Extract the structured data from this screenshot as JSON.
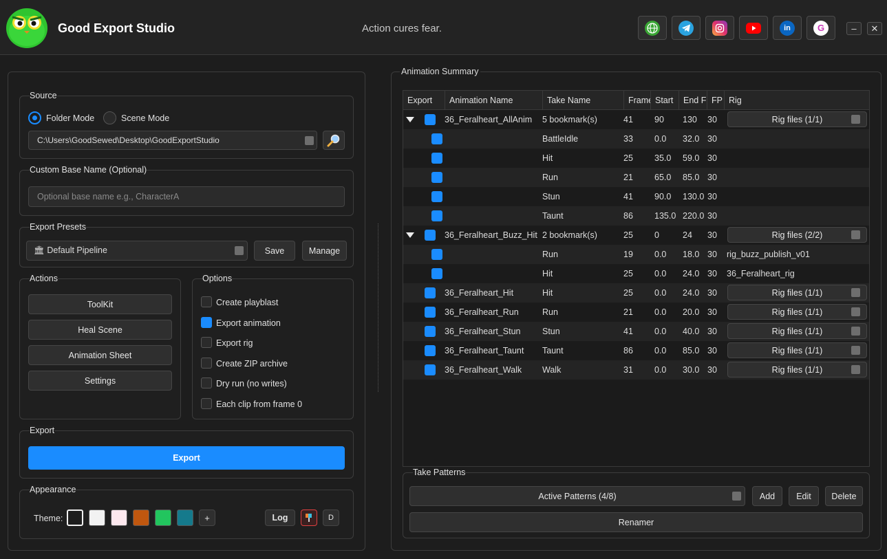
{
  "app": {
    "title": "Good Export Studio",
    "tagline": "Action cures fear."
  },
  "social_icons": [
    {
      "name": "globe-icon",
      "color": "#3aa635"
    },
    {
      "name": "telegram-icon",
      "color": "#2aa3e0"
    },
    {
      "name": "instagram-icon",
      "color": "#e1306c"
    },
    {
      "name": "youtube-icon",
      "color": "#ff0000"
    },
    {
      "name": "linkedin-icon",
      "color": "#0a66c2"
    },
    {
      "name": "g-logo-icon",
      "color": "#e040c0",
      "glyph": "G"
    }
  ],
  "window": {
    "minimize": "–",
    "close": "✕"
  },
  "source": {
    "title": "Source",
    "folder_mode": "Folder Mode",
    "scene_mode": "Scene Mode",
    "path": "C:\\Users\\GoodSewed\\Desktop\\GoodExportStudio"
  },
  "base_name": {
    "title": "Custom Base Name (Optional)",
    "placeholder": "Optional base name e.g., CharacterA"
  },
  "presets": {
    "title": "Export Presets",
    "selected": "🏛 Default Pipeline",
    "save": "Save",
    "manage": "Manage"
  },
  "actions": {
    "title": "Actions",
    "buttons": [
      "ToolKit",
      "Heal Scene",
      "Animation Sheet",
      "Settings"
    ]
  },
  "options": {
    "title": "Options",
    "items": [
      {
        "label": "Create playblast",
        "checked": false
      },
      {
        "label": "Export animation",
        "checked": true
      },
      {
        "label": "Export rig",
        "checked": false
      },
      {
        "label": "Create ZIP archive",
        "checked": false
      },
      {
        "label": "Dry run (no writes)",
        "checked": false
      },
      {
        "label": "Each clip from frame 0",
        "checked": false
      }
    ]
  },
  "export": {
    "title": "Export",
    "button": "Export"
  },
  "appearance": {
    "title": "Appearance",
    "theme_label": "Theme:",
    "themes": [
      "#1e1e1e",
      "#f2f2f2",
      "#fde8ee",
      "#c0570f",
      "#22c55e",
      "#157a8c"
    ],
    "add": "+",
    "log": "Log",
    "d": "D"
  },
  "summary": {
    "title": "Animation Summary",
    "columns": [
      "Export",
      "Animation Name",
      "Take Name",
      "Frame",
      "Start",
      "End F",
      "FP",
      "Rig"
    ],
    "rows": [
      {
        "level": 0,
        "expand": true,
        "name": "36_Feralheart_AllAnim",
        "take": "5 bookmark(s)",
        "frames": "41",
        "start": "90",
        "end": "130",
        "fps": "30",
        "rig": "Rig files (1/1)",
        "rig_button": true
      },
      {
        "level": 1,
        "name": "",
        "take": "BattleIdle",
        "frames": "33",
        "start": "0.0",
        "end": "32.0",
        "fps": "30",
        "rig": ""
      },
      {
        "level": 1,
        "name": "",
        "take": "Hit",
        "frames": "25",
        "start": "35.0",
        "end": "59.0",
        "fps": "30",
        "rig": ""
      },
      {
        "level": 1,
        "name": "",
        "take": "Run",
        "frames": "21",
        "start": "65.0",
        "end": "85.0",
        "fps": "30",
        "rig": ""
      },
      {
        "level": 1,
        "name": "",
        "take": "Stun",
        "frames": "41",
        "start": "90.0",
        "end": "130.0",
        "fps": "30",
        "rig": ""
      },
      {
        "level": 1,
        "name": "",
        "take": "Taunt",
        "frames": "86",
        "start": "135.0",
        "end": "220.0",
        "fps": "30",
        "rig": ""
      },
      {
        "level": 0,
        "expand": true,
        "name": "36_Feralheart_Buzz_Hit",
        "take": "2 bookmark(s)",
        "frames": "25",
        "start": "0",
        "end": "24",
        "fps": "30",
        "rig": "Rig files (2/2)",
        "rig_button": true
      },
      {
        "level": 1,
        "name": "",
        "take": "Run",
        "frames": "19",
        "start": "0.0",
        "end": "18.0",
        "fps": "30",
        "rig": "rig_buzz_publish_v01"
      },
      {
        "level": 1,
        "name": "",
        "take": "Hit",
        "frames": "25",
        "start": "0.0",
        "end": "24.0",
        "fps": "30",
        "rig": "36_Feralheart_rig"
      },
      {
        "level": 0,
        "name": "36_Feralheart_Hit",
        "take": "Hit",
        "frames": "25",
        "start": "0.0",
        "end": "24.0",
        "fps": "30",
        "rig": "Rig files (1/1)",
        "rig_button": true
      },
      {
        "level": 0,
        "name": "36_Feralheart_Run",
        "take": "Run",
        "frames": "21",
        "start": "0.0",
        "end": "20.0",
        "fps": "30",
        "rig": "Rig files (1/1)",
        "rig_button": true
      },
      {
        "level": 0,
        "name": "36_Feralheart_Stun",
        "take": "Stun",
        "frames": "41",
        "start": "0.0",
        "end": "40.0",
        "fps": "30",
        "rig": "Rig files (1/1)",
        "rig_button": true
      },
      {
        "level": 0,
        "name": "36_Feralheart_Taunt",
        "take": "Taunt",
        "frames": "86",
        "start": "0.0",
        "end": "85.0",
        "fps": "30",
        "rig": "Rig files (1/1)",
        "rig_button": true
      },
      {
        "level": 0,
        "name": "36_Feralheart_Walk",
        "take": "Walk",
        "frames": "31",
        "start": "0.0",
        "end": "30.0",
        "fps": "30",
        "rig": "Rig files (1/1)",
        "rig_button": true
      }
    ]
  },
  "take_patterns": {
    "title": "Take Patterns",
    "active": "Active Patterns (4/8)",
    "add": "Add",
    "edit": "Edit",
    "delete": "Delete",
    "renamer": "Renamer"
  },
  "colors": {
    "accent": "#1a8cff"
  }
}
